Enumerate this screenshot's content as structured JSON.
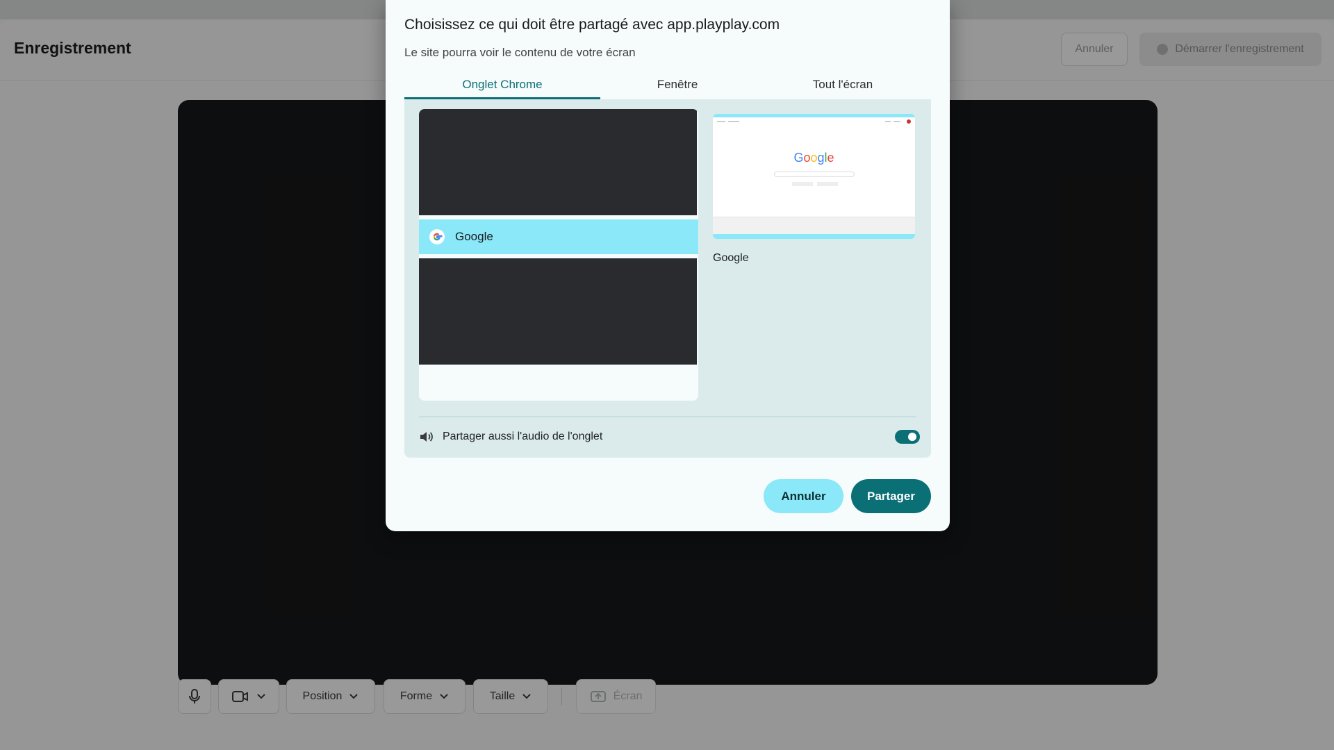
{
  "app": {
    "title": "Enregistrement",
    "cancel_label": "Annuler",
    "start_label": "Démarrer l'enregistrement"
  },
  "toolbar": {
    "mic_icon": "microphone-icon",
    "camera_icon": "camera-icon",
    "position_label": "Position",
    "shape_label": "Forme",
    "size_label": "Taille",
    "screen_label": "Écran"
  },
  "dialog": {
    "title": "Choisissez ce qui doit être partagé avec app.playplay.com",
    "subtitle": "Le site pourra voir le contenu de votre écran",
    "tabs": [
      {
        "label": "Onglet Chrome",
        "active": true
      },
      {
        "label": "Fenêtre",
        "active": false
      },
      {
        "label": "Tout l'écran",
        "active": false
      }
    ],
    "list_items": [
      {
        "label": "Google",
        "selected": true
      }
    ],
    "preview": {
      "label": "Google",
      "logo_text": "Google"
    },
    "audio": {
      "label": "Partager aussi l'audio de l'onglet",
      "enabled": true
    },
    "cancel_label": "Annuler",
    "share_label": "Partager"
  },
  "colors": {
    "accent": "#0b6f76",
    "highlight": "#8ae8f8",
    "panel": "#dbebec"
  }
}
